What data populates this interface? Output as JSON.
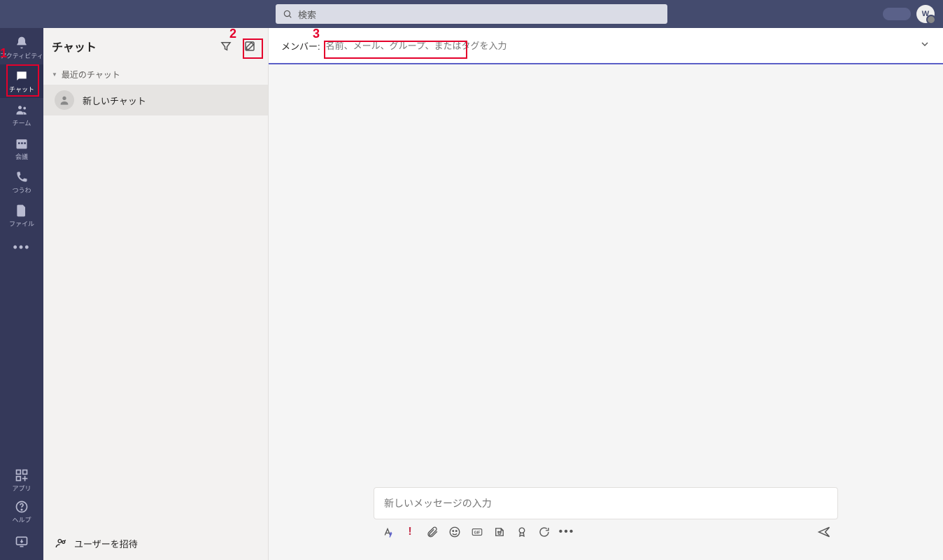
{
  "titlebar": {
    "search_placeholder": "検索",
    "avatar_initial": "W"
  },
  "rail": {
    "items": [
      {
        "key": "activity",
        "label": "アクティビティ"
      },
      {
        "key": "chat",
        "label": "チャット"
      },
      {
        "key": "team",
        "label": "チーム"
      },
      {
        "key": "meetings",
        "label": "会議"
      },
      {
        "key": "calls",
        "label": "つうわ"
      },
      {
        "key": "files",
        "label": "ファイル"
      }
    ],
    "apps_label": "アプリ",
    "help_label": "ヘルプ"
  },
  "chatlist": {
    "title": "チャット",
    "section_recent": "最近のチャット",
    "items": [
      {
        "name": "新しいチャット"
      }
    ],
    "invite_label": "ユーザーを招待"
  },
  "conversation": {
    "member_label": "メンバー:",
    "member_placeholder": "名前、メール、グループ、またはタグを入力",
    "compose_placeholder": "新しいメッセージの入力"
  },
  "annotations": {
    "n1": "1",
    "n2": "2",
    "n3": "3"
  }
}
